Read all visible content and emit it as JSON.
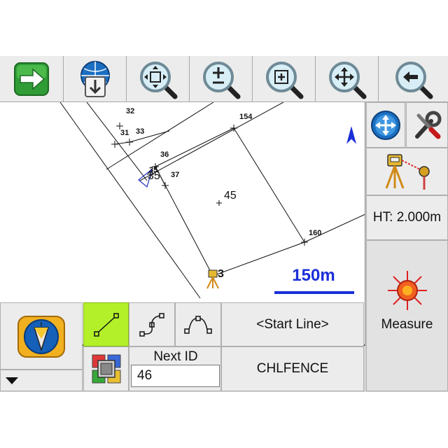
{
  "toolbar": {
    "icons": [
      "forward-arrow-icon",
      "import-download-icon",
      "zoom-extents-icon",
      "zoom-in-out-icon",
      "zoom-window-icon",
      "pan-icon",
      "zoom-previous-icon"
    ]
  },
  "map": {
    "north_arrow": "north-arrow-icon",
    "points": [
      {
        "id": "32"
      },
      {
        "id": "31"
      },
      {
        "id": "33"
      },
      {
        "id": "154"
      },
      {
        "id": "36"
      },
      {
        "id": "35"
      },
      {
        "id": "35"
      },
      {
        "id": "37"
      },
      {
        "id": "45"
      },
      {
        "id": "160"
      },
      {
        "id": "3"
      }
    ],
    "scale_label": "150m"
  },
  "side_panel": {
    "ht_label": "HT: 2.000m",
    "measure_label": "Measure"
  },
  "bottom_panel": {
    "start_line_label": "<Start Line>",
    "code_label": "CHLFENCE",
    "next_id_label": "Next ID",
    "next_id_value": "46"
  },
  "colors": {
    "accent_green": "#b3f02a",
    "scale_blue": "#1a2fd8",
    "north_blue": "#1a2fd8"
  }
}
